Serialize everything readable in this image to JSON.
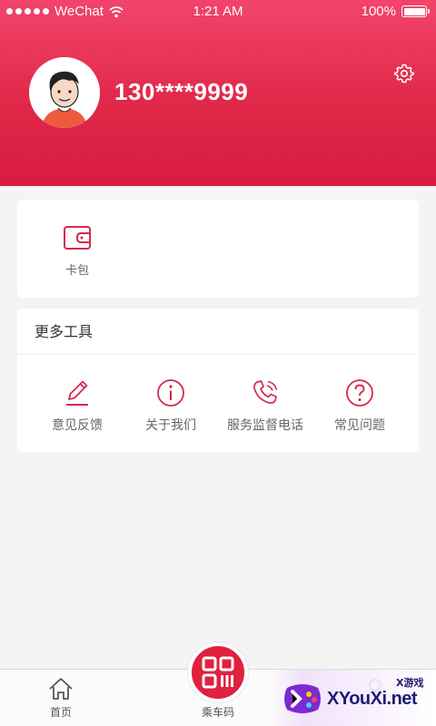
{
  "status_bar": {
    "carrier": "WeChat",
    "time": "1:21 AM",
    "battery_text": "100%",
    "signal_icon": "signal-dots-icon",
    "wifi_icon": "wifi-icon",
    "battery_icon": "battery-icon"
  },
  "profile": {
    "phone": "130****9999",
    "avatar_icon": "user-avatar",
    "settings_icon": "gear-icon"
  },
  "wallet": {
    "label": "卡包",
    "icon": "wallet-icon"
  },
  "tools": {
    "title": "更多工具",
    "items": [
      {
        "label": "意见反馈",
        "icon": "pencil-icon"
      },
      {
        "label": "关于我们",
        "icon": "info-icon"
      },
      {
        "label": "服务监督电话",
        "icon": "phone-icon"
      },
      {
        "label": "常见问题",
        "icon": "question-icon"
      }
    ]
  },
  "tabbar": {
    "home_label": "首页",
    "ride_label": "乘车码",
    "home_icon": "home-icon",
    "ride_icon": "qr-code-icon",
    "my_icon": "user-icon"
  },
  "watermark": {
    "text": "XYouXi.net",
    "subtext": "X游戏"
  },
  "colors": {
    "accent": "#e0213f",
    "header_top": "#f2456b",
    "header_bottom": "#d81c3f",
    "background": "#f4f4f4"
  }
}
